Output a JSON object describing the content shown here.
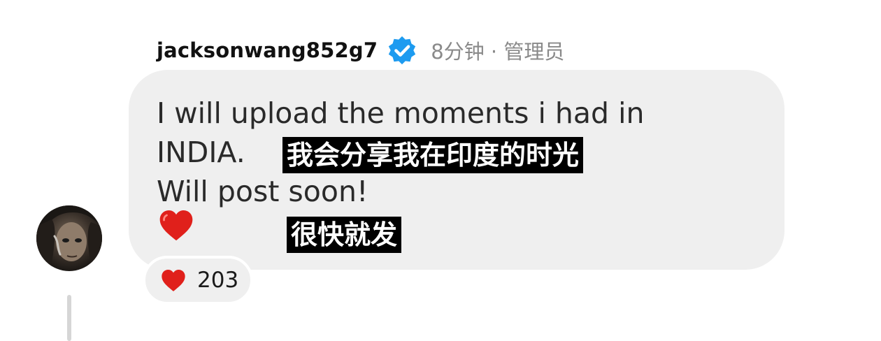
{
  "comment": {
    "username": "jacksonwang852g7",
    "verified_icon": "verified-badge-icon",
    "meta": "8分钟 · 管理员",
    "text_lines": [
      "I will upload the moments i had in",
      "INDIA.",
      "Will post soon!"
    ],
    "emoji_icon": "red-heart-icon",
    "reaction_count": "203"
  },
  "captions": {
    "line1": "我会分享我在印度的时光",
    "line2": "很快就发"
  },
  "colors": {
    "bubble": "#efefef",
    "verified_blue": "#1d9bf0",
    "heart_red": "#e0201b",
    "meta_gray": "#8a8a8a"
  }
}
